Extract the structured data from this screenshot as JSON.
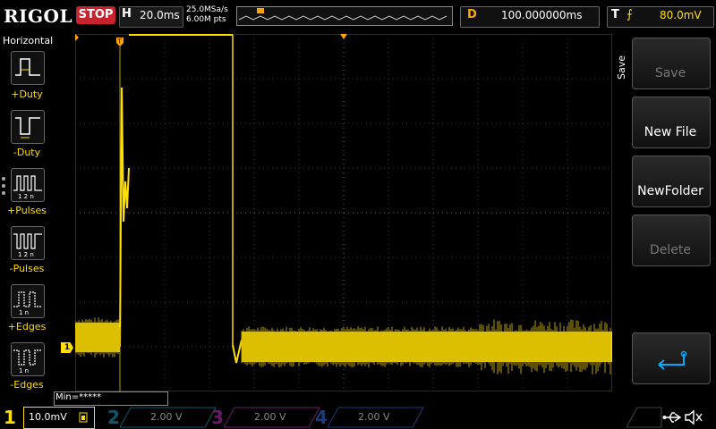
{
  "header": {
    "brand": "RIGOL",
    "run_state": "STOP",
    "horizontal_letter": "H",
    "timebase": "20.0ms",
    "sample_rate": "25.0MSa/s",
    "memory_depth": "6.00M pts",
    "delay_letter": "D",
    "delay_value": "100.000000ms",
    "trigger_letter": "T",
    "trigger_edge_symbol": "⨍",
    "trigger_level": "80.0mV"
  },
  "left_menu": {
    "title": "Horizontal",
    "items": [
      {
        "label": "+Duty",
        "icon": "positive-duty-icon"
      },
      {
        "label": "-Duty",
        "icon": "negative-duty-icon"
      },
      {
        "label": "+Pulses",
        "icon": "positive-pulses-icon"
      },
      {
        "label": "-Pulses",
        "icon": "negative-pulses-icon"
      },
      {
        "label": "+Edges",
        "icon": "positive-edges-icon"
      },
      {
        "label": "-Edges",
        "icon": "negative-edges-icon"
      }
    ]
  },
  "right_menu": {
    "title": "Save",
    "items": [
      {
        "label": "Save",
        "enabled": false
      },
      {
        "label": "New File",
        "enabled": true
      },
      {
        "label": "NewFolder",
        "enabled": true
      },
      {
        "label": "Delete",
        "enabled": false
      },
      {
        "label": "",
        "icon": "return-arrow-icon",
        "enabled": true
      }
    ]
  },
  "measurement": {
    "text": "Min=*****"
  },
  "channel_marker": "1",
  "channels": [
    {
      "num": "1",
      "scale": "10.0mV",
      "color": "#ffde00",
      "active": true
    },
    {
      "num": "2",
      "scale": "2.00 V",
      "color": "#00c8ff",
      "active": false
    },
    {
      "num": "3",
      "scale": "2.00 V",
      "color": "#ff00ff",
      "active": false
    },
    {
      "num": "4",
      "scale": "2.00 V",
      "color": "#2b6cff",
      "active": false
    }
  ],
  "colors": {
    "trace": "#ffde00",
    "accent_orange": "#ffa500",
    "stop_red": "#c8232c"
  }
}
